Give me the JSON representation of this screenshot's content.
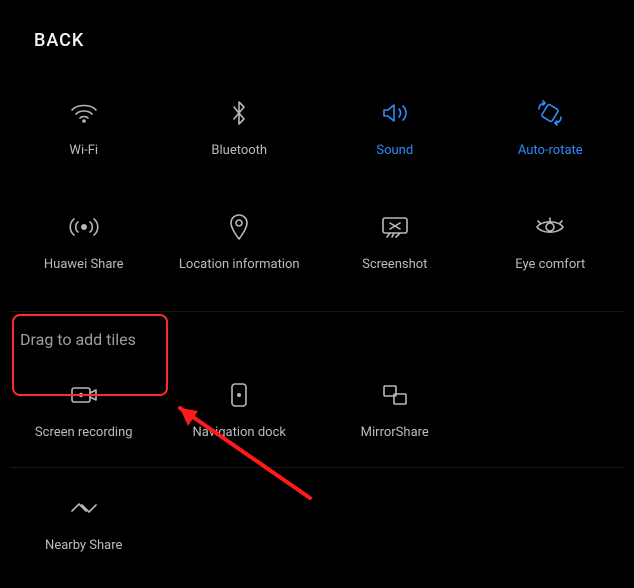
{
  "header": {
    "back_label": "BACK"
  },
  "active_row": {
    "tiles": [
      {
        "id": "wifi",
        "label": "Wi-Fi",
        "active": false
      },
      {
        "id": "bluetooth",
        "label": "Bluetooth",
        "active": false
      },
      {
        "id": "sound",
        "label": "Sound",
        "active": true
      },
      {
        "id": "autorotate",
        "label": "Auto-rotate",
        "active": true
      }
    ]
  },
  "second_row": {
    "tiles": [
      {
        "id": "huawei-share",
        "label": "Huawei Share",
        "active": false
      },
      {
        "id": "location",
        "label": "Location information",
        "active": false
      },
      {
        "id": "screenshot",
        "label": "Screenshot",
        "active": false
      },
      {
        "id": "eye-comfort",
        "label": "Eye comfort",
        "active": false
      }
    ]
  },
  "available": {
    "section_title": "Drag to add tiles",
    "tiles_row1": [
      {
        "id": "screen-recording",
        "label": "Screen recording"
      },
      {
        "id": "navigation-dock",
        "label": "Navigation dock"
      },
      {
        "id": "mirror-share",
        "label": "MirrorShare"
      }
    ],
    "tiles_row2": [
      {
        "id": "nearby-share",
        "label": "Nearby Share"
      }
    ]
  },
  "annotation": {
    "highlight_target": "screen-recording"
  }
}
